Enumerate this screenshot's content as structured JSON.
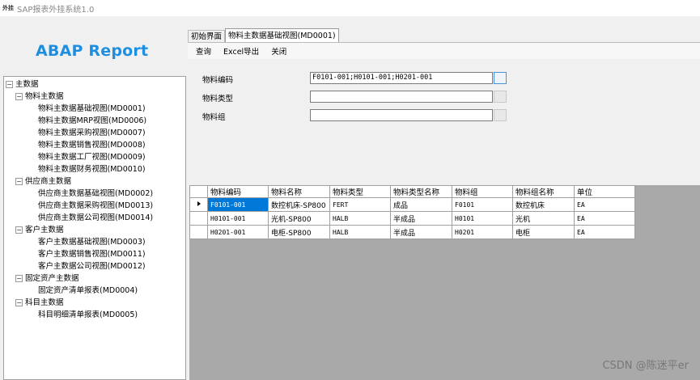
{
  "window": {
    "app_icon_text": "外挂",
    "title": "SAP报表外挂系统1.0"
  },
  "logo": "ABAP Report",
  "tree": [
    {
      "level": 0,
      "toggle": "−",
      "label": "主数据"
    },
    {
      "level": 1,
      "toggle": "−",
      "label": "物料主数据"
    },
    {
      "level": 2,
      "toggle": "",
      "label": "物料主数据基础视图(MD0001)"
    },
    {
      "level": 2,
      "toggle": "",
      "label": "物料主数据MRP视图(MD0006)"
    },
    {
      "level": 2,
      "toggle": "",
      "label": "物料主数据采购视图(MD0007)"
    },
    {
      "level": 2,
      "toggle": "",
      "label": "物料主数据销售视图(MD0008)"
    },
    {
      "level": 2,
      "toggle": "",
      "label": "物料主数据工厂视图(MD0009)"
    },
    {
      "level": 2,
      "toggle": "",
      "label": "物料主数据财务视图(MD0010)"
    },
    {
      "level": 1,
      "toggle": "−",
      "label": "供应商主数据"
    },
    {
      "level": 2,
      "toggle": "",
      "label": "供应商主数据基础视图(MD0002)"
    },
    {
      "level": 2,
      "toggle": "",
      "label": "供应商主数据采购视图(MD0013)"
    },
    {
      "level": 2,
      "toggle": "",
      "label": "供应商主数据公司视图(MD0014)"
    },
    {
      "level": 1,
      "toggle": "−",
      "label": "客户主数据"
    },
    {
      "level": 2,
      "toggle": "",
      "label": "客户主数据基础视图(MD0003)"
    },
    {
      "level": 2,
      "toggle": "",
      "label": "客户主数据销售视图(MD0011)"
    },
    {
      "level": 2,
      "toggle": "",
      "label": "客户主数据公司视图(MD0012)"
    },
    {
      "level": 1,
      "toggle": "−",
      "label": "固定资产主数据"
    },
    {
      "level": 2,
      "toggle": "",
      "label": "固定资产清单报表(MD0004)"
    },
    {
      "level": 1,
      "toggle": "−",
      "label": "科目主数据"
    },
    {
      "level": 2,
      "toggle": "",
      "label": "科目明细清单报表(MD0005)"
    }
  ],
  "tabs": [
    {
      "label": "初始界面",
      "active": false
    },
    {
      "label": "物料主数据基础视图(MD0001)",
      "active": true
    }
  ],
  "toolbar": {
    "query": "查询",
    "excel_export": "Excel导出",
    "close": "关闭"
  },
  "form": {
    "material_code_label": "物料编码",
    "material_code_value": "F0101-001;H0101-001;H0201-001",
    "material_type_label": "物料类型",
    "material_type_value": "",
    "material_group_label": "物料组",
    "material_group_value": ""
  },
  "grid": {
    "columns": [
      "物料编码",
      "物料名称",
      "物料类型",
      "物料类型名称",
      "物料组",
      "物料组名称",
      "单位"
    ],
    "rows": [
      [
        "F0101-001",
        "数控机床-SP800",
        "FERT",
        "成品",
        "F0101",
        "数控机床",
        "EA"
      ],
      [
        "H0101-001",
        "光机-SP800",
        "HALB",
        "半成品",
        "H0101",
        "光机",
        "EA"
      ],
      [
        "H0201-001",
        "电柜-SP800",
        "HALB",
        "半成品",
        "H0201",
        "电柜",
        "EA"
      ]
    ],
    "selected_row": 0
  },
  "watermark": "CSDN @陈迷平er"
}
